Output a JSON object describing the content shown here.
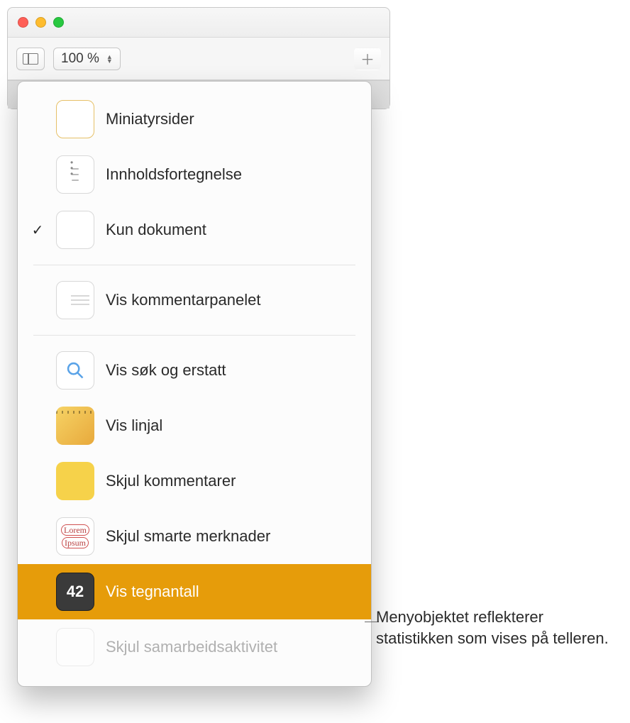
{
  "toolbar": {
    "zoom_label": "100 %"
  },
  "menu": {
    "items": [
      {
        "label": "Miniatyrsider"
      },
      {
        "label": "Innholdsfortegnelse"
      },
      {
        "label": "Kun dokument"
      },
      {
        "label": "Vis kommentarpanelet"
      },
      {
        "label": "Vis søk og erstatt"
      },
      {
        "label": "Vis linjal"
      },
      {
        "label": "Skjul kommentarer"
      },
      {
        "label": "Skjul smarte merknader"
      },
      {
        "label": "Vis tegnantall"
      },
      {
        "label": "Skjul samarbeidsaktivitet"
      }
    ],
    "count_badge": "42"
  },
  "callout": {
    "text": "Menyobjektet reflekterer statistikken som vises på telleren."
  }
}
